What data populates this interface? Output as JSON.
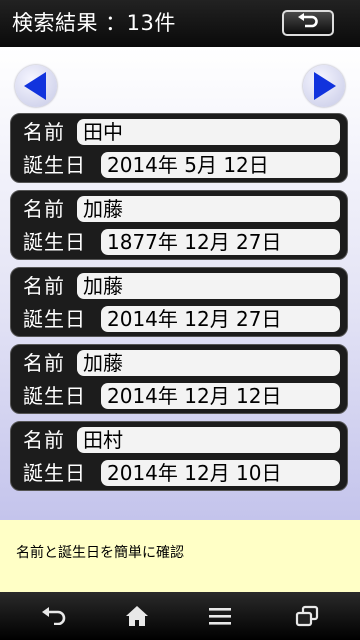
{
  "header": {
    "title": "検索結果 ：13件",
    "back_icon": "undo-arrow-icon"
  },
  "navigation": {
    "prev_icon": "left-arrow-icon",
    "next_icon": "right-arrow-icon"
  },
  "labels": {
    "name": "名前",
    "birthday": "誕生日"
  },
  "records": [
    {
      "name": "田中",
      "birthday": "2014年 5月 12日"
    },
    {
      "name": "加藤",
      "birthday": "1877年 12月 27日"
    },
    {
      "name": "加藤",
      "birthday": "2014年 12月 27日"
    },
    {
      "name": "加藤",
      "birthday": "2014年 12月 12日"
    },
    {
      "name": "田村",
      "birthday": "2014年 12月 10日"
    }
  ],
  "banner": {
    "text": "名前と誕生日を簡単に確認"
  },
  "system_nav": {
    "back": "back-icon",
    "home": "home-icon",
    "menu": "menu-icon",
    "recents": "recent-apps-icon"
  },
  "colors": {
    "accent_arrow": "#1133dd",
    "banner_bg": "#ffffc6",
    "record_bg": "#1c1c1c"
  }
}
